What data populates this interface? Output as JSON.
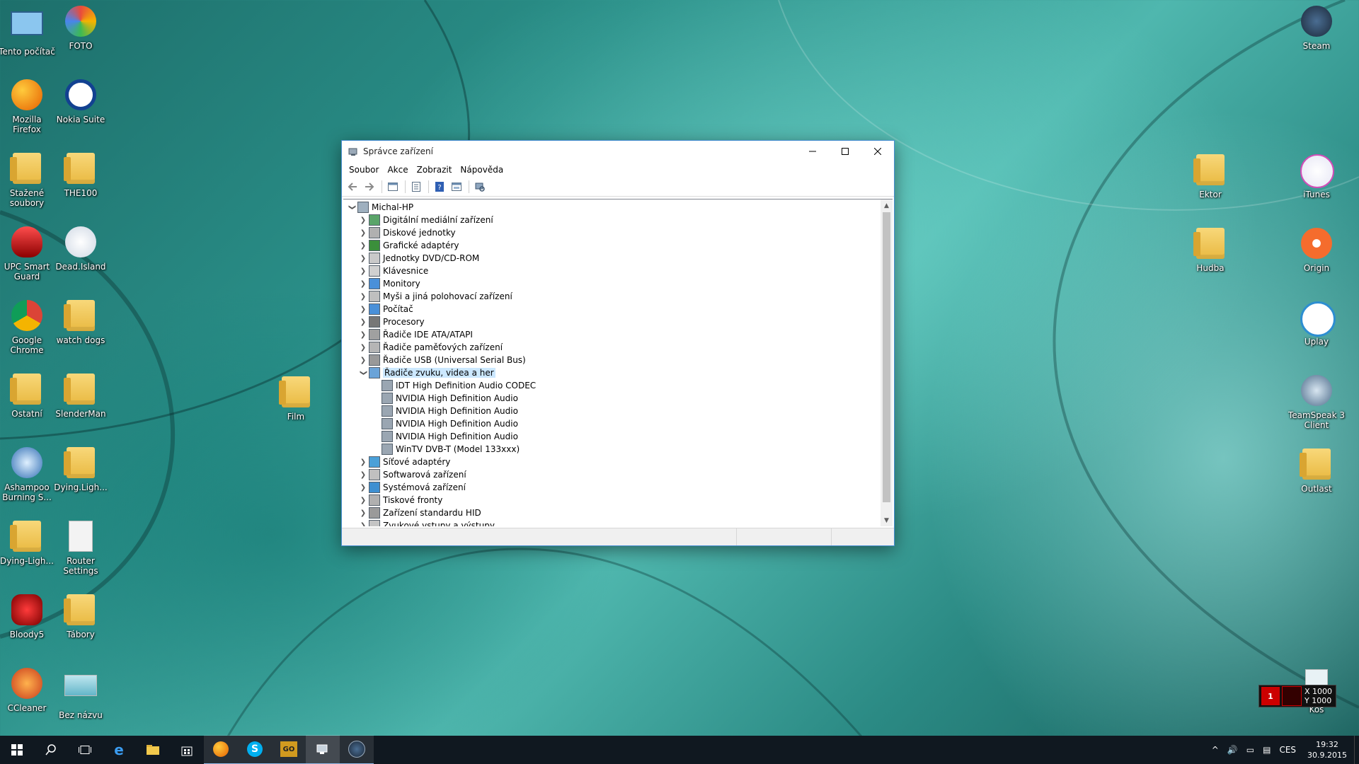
{
  "desktop": {
    "icons_left": [
      {
        "label": "Tento počítač",
        "icon": "computer-icon"
      },
      {
        "label": "FOTO",
        "icon": "photos-icon"
      },
      {
        "label": "Mozilla Firefox",
        "icon": "firefox-icon"
      },
      {
        "label": "Nokia Suite",
        "icon": "nokia-suite-icon"
      },
      {
        "label": "Stažené soubory",
        "icon": "folder-icon"
      },
      {
        "label": "THE100",
        "icon": "folder-icon"
      },
      {
        "label": "UPC Smart Guard",
        "icon": "shield-icon"
      },
      {
        "label": "Dead.Island",
        "icon": "lightning-icon"
      },
      {
        "label": "Google Chrome",
        "icon": "chrome-icon"
      },
      {
        "label": "watch dogs",
        "icon": "folder-icon"
      },
      {
        "label": "Ostatní",
        "icon": "folder-icon"
      },
      {
        "label": "SlenderMan",
        "icon": "folder-icon"
      },
      {
        "label": "Ashampoo Burning S...",
        "icon": "ashampoo-icon"
      },
      {
        "label": "Dying.Ligh...",
        "icon": "folder-icon"
      },
      {
        "label": "Dying-Ligh...",
        "icon": "folder-icon"
      },
      {
        "label": "Router Settings",
        "icon": "document-icon"
      },
      {
        "label": "Bloody5",
        "icon": "bloody-icon"
      },
      {
        "label": "Tábory",
        "icon": "folder-icon"
      },
      {
        "label": "CCleaner",
        "icon": "ccleaner-icon"
      },
      {
        "label": "Bez názvu",
        "icon": "image-icon"
      }
    ],
    "icon_film": {
      "label": "Film",
      "icon": "folder-icon"
    },
    "icons_right": [
      {
        "label": "Steam",
        "icon": "steam-icon"
      },
      {
        "label": "Ektor",
        "icon": "folder-icon"
      },
      {
        "label": "iTunes",
        "icon": "itunes-icon"
      },
      {
        "label": "Hudba",
        "icon": "folder-icon"
      },
      {
        "label": "Origin",
        "icon": "origin-icon"
      },
      {
        "label": "Uplay",
        "icon": "uplay-icon"
      },
      {
        "label": "TeamSpeak 3 Client",
        "icon": "teamspeak-icon"
      },
      {
        "label": "Outlast",
        "icon": "folder-icon"
      },
      {
        "label": "Koš",
        "icon": "recycle-bin-icon"
      }
    ]
  },
  "window": {
    "title": "Správce zařízení",
    "menu": [
      "Soubor",
      "Akce",
      "Zobrazit",
      "Nápověda"
    ],
    "tree": {
      "root": "Michal-HP",
      "categories": [
        {
          "label": "Digitální mediální zařízení",
          "expanded": false
        },
        {
          "label": "Diskové jednotky",
          "expanded": false
        },
        {
          "label": "Grafické adaptéry",
          "expanded": false
        },
        {
          "label": "Jednotky DVD/CD-ROM",
          "expanded": false
        },
        {
          "label": "Klávesnice",
          "expanded": false
        },
        {
          "label": "Monitory",
          "expanded": false
        },
        {
          "label": "Myši a jiná polohovací zařízení",
          "expanded": false
        },
        {
          "label": "Počítač",
          "expanded": false
        },
        {
          "label": "Procesory",
          "expanded": false
        },
        {
          "label": "Řadiče IDE ATA/ATAPI",
          "expanded": false
        },
        {
          "label": "Řadiče paměťových zařízení",
          "expanded": false
        },
        {
          "label": "Řadiče USB (Universal Serial Bus)",
          "expanded": false
        },
        {
          "label": "Řadiče zvuku, videa a her",
          "expanded": true,
          "selected": true,
          "children": [
            "IDT High Definition Audio CODEC",
            "NVIDIA High Definition Audio",
            "NVIDIA High Definition Audio",
            "NVIDIA High Definition Audio",
            "NVIDIA High Definition Audio",
            "WinTV DVB-T (Model 133xxx)"
          ]
        },
        {
          "label": "Síťové adaptéry",
          "expanded": false
        },
        {
          "label": "Softwarová zařízení",
          "expanded": false
        },
        {
          "label": "Systémová zařízení",
          "expanded": false
        },
        {
          "label": "Tiskové fronty",
          "expanded": false
        },
        {
          "label": "Zařízení standardu HID",
          "expanded": false
        },
        {
          "label": "Zvukové vstupy a výstupy",
          "expanded": false
        }
      ]
    }
  },
  "overlay": {
    "x_label": "X 1000",
    "y_label": "Y 1000"
  },
  "taskbar": {
    "apps": [
      "start-icon",
      "search-icon",
      "task-view-icon",
      "edge-icon",
      "file-explorer-icon",
      "store-icon",
      "firefox-icon",
      "skype-icon",
      "csgo-icon",
      "device-manager-icon",
      "steam-icon"
    ],
    "language": "CES",
    "time": "19:32",
    "date": "30.9.2015"
  },
  "colors": {
    "selection": "#cce8ff",
    "taskbar": "#101820",
    "accent": "#4a8fd4"
  }
}
